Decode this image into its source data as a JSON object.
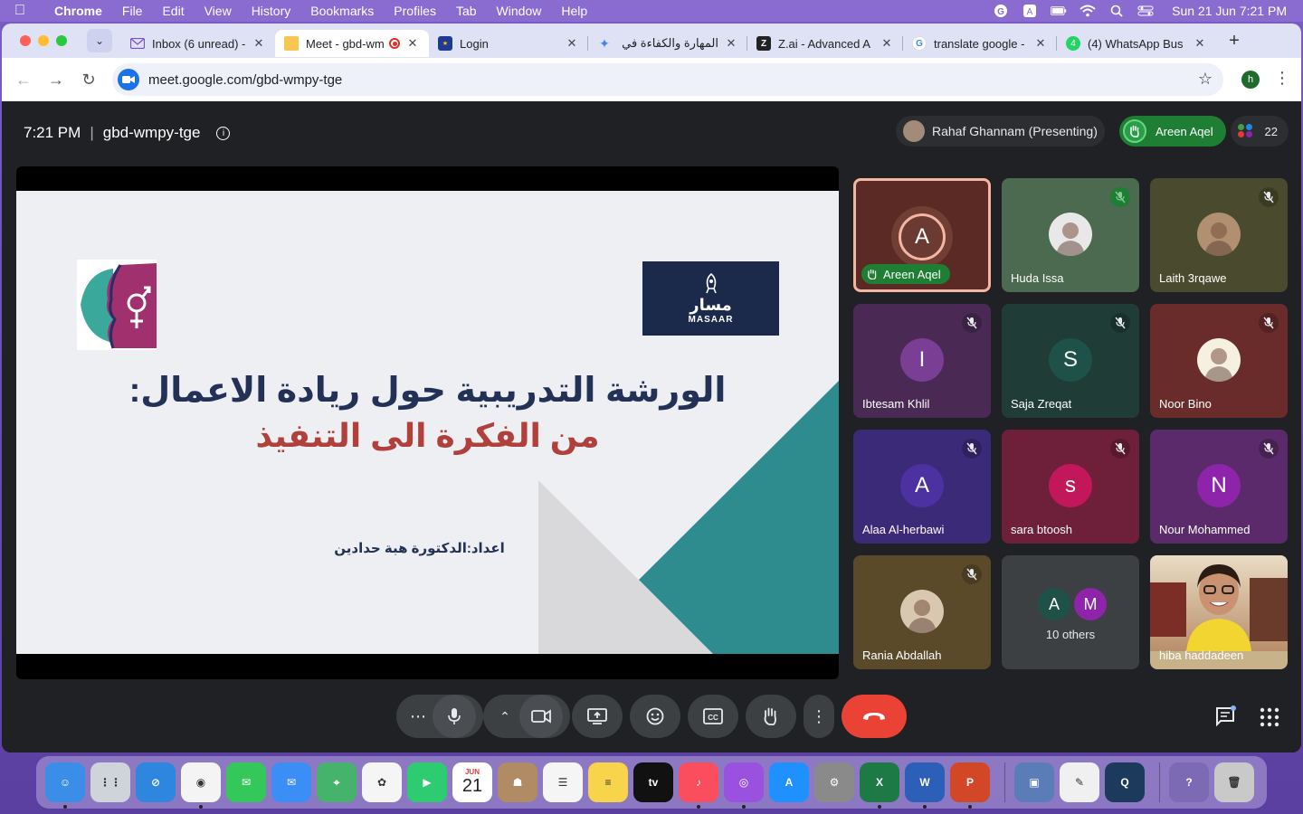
{
  "menubar": {
    "app": "Chrome",
    "items": [
      "File",
      "Edit",
      "View",
      "History",
      "Bookmarks",
      "Profiles",
      "Tab",
      "Window",
      "Help"
    ],
    "clock": "Sun 21 Jun  7:21 PM"
  },
  "tabs": [
    {
      "title": "Inbox (6 unread) -",
      "favicon": "mail-icon",
      "active": false
    },
    {
      "title": "Meet - gbd-wm",
      "favicon": "meet-icon",
      "active": true
    },
    {
      "title": "Login",
      "favicon": "eu-flag-icon",
      "active": false
    },
    {
      "title": "المهارة والكفاءة في حر",
      "favicon": "gemini-icon",
      "active": false
    },
    {
      "title": "Z.ai - Advanced A",
      "favicon": "zai-icon",
      "active": false
    },
    {
      "title": "translate google -",
      "favicon": "google-icon",
      "active": false
    },
    {
      "title": "(4) WhatsApp Bus",
      "favicon": "whatsapp-icon",
      "active": false
    }
  ],
  "address": {
    "url": "meet.google.com/gbd-wmpy-tge",
    "profile_initial": "h"
  },
  "meeting": {
    "time": "7:21 PM",
    "code": "gbd-wmpy-tge",
    "presenting": "Rahaf Ghannam (Presenting)",
    "raised_hand": "Areen Aqel",
    "participant_count": "22"
  },
  "slide": {
    "logo_right_ar": "مسار",
    "logo_right_en": "MASAAR",
    "title_line1": "الورشة التدريبية حول ريادة الاعمال:",
    "title_line2": "من الفكرة الى التنفيذ",
    "author": "اعداد:الدكتورة هبة حدادين"
  },
  "participants": [
    {
      "name": "Areen Aqel",
      "initial": "A",
      "bg": "#5b2a24",
      "avatar_color": "#6b3a33",
      "muted": false,
      "speaker": true,
      "hand": true
    },
    {
      "name": "Huda Issa",
      "initial": "",
      "bg": "#4c6a4f",
      "avatar_color": "#e8e8e8",
      "muted": true,
      "mute_style": "green"
    },
    {
      "name": "Laith 3rqawe",
      "initial": "",
      "bg": "#4a4a2e",
      "avatar_color": "#b09070",
      "muted": true
    },
    {
      "name": "Ibtesam Khlil",
      "initial": "I",
      "bg": "#4a2a55",
      "avatar_color": "#7a3f94",
      "muted": true
    },
    {
      "name": "Saja Zreqat",
      "initial": "S",
      "bg": "#1f3d36",
      "avatar_color": "#1e5248",
      "muted": true
    },
    {
      "name": "Noor Bino",
      "initial": "",
      "bg": "#6a2b2b",
      "avatar_color": "#f5f0e0",
      "muted": true
    },
    {
      "name": "Alaa Al-herbawi",
      "initial": "A",
      "bg": "#3b2a78",
      "avatar_color": "#4b32a0",
      "muted": true
    },
    {
      "name": "sara btoosh",
      "initial": "s",
      "bg": "#6e1f3a",
      "avatar_color": "#c2185b",
      "muted": true
    },
    {
      "name": "Nour Mohammed",
      "initial": "N",
      "bg": "#5a2a6a",
      "avatar_color": "#8e24aa",
      "muted": true
    },
    {
      "name": "Rania Abdallah",
      "initial": "",
      "bg": "#5a4a2a",
      "avatar_color": "#d8c8b0",
      "muted": true
    },
    {
      "name": "10 others",
      "initial": "",
      "bg": "#3c4043",
      "others": [
        "A",
        "M"
      ]
    },
    {
      "name": "hiba haddadeen",
      "initial": "",
      "bg": "#c8b28a",
      "video": true
    }
  ],
  "dock": [
    "Finder",
    "Launchpad",
    "Safari",
    "Chrome",
    "Messages",
    "Mail",
    "Maps",
    "Photos",
    "FaceTime",
    "Calendar",
    "Contacts",
    "Reminders",
    "Notes",
    "TV",
    "Music",
    "Podcasts",
    "App Store",
    "System Settings",
    "Excel",
    "Word",
    "PowerPoint",
    "Preview",
    "TextEdit",
    "QuickTime",
    "Help",
    "Trash"
  ],
  "dock_calendar": {
    "month": "JUN",
    "day": "21"
  }
}
